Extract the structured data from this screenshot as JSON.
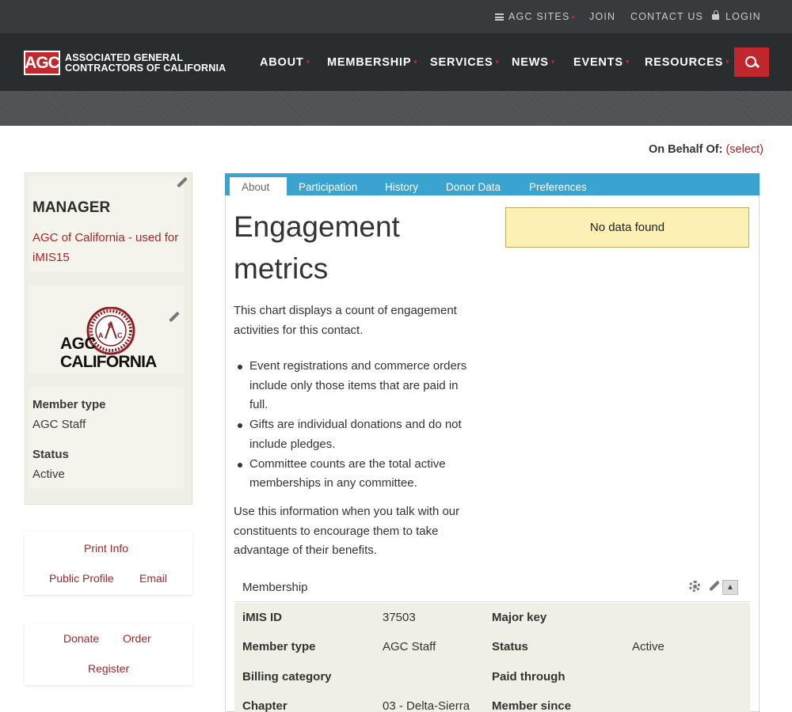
{
  "topbar": {
    "agc_sites": "AGC SITES",
    "join": "JOIN",
    "contact_us": "CONTACT US",
    "login": "LOGIN"
  },
  "brand": {
    "logo_mark": "AGC",
    "line1": "ASSOCIATED GENERAL",
    "line2": "CONTRACTORS OF CALIFORNIA",
    "accent_color": "#c0282d"
  },
  "nav": {
    "items": [
      "ABOUT",
      "MEMBERSHIP",
      "SERVICES",
      "NEWS",
      "EVENTS",
      "RESOURCES"
    ]
  },
  "behalf": {
    "label": "On Behalf Of:",
    "link": "(select)"
  },
  "sidebar": {
    "role": "MANAGER",
    "org_link": "AGC of California - used for iMIS15",
    "logo_line1": "AGC",
    "logo_line2": "CALIFORNIA",
    "member_type_label": "Member type",
    "member_type_value": "AGC Staff",
    "status_label": "Status",
    "status_value": "Active",
    "links1": {
      "print_info": "Print Info",
      "public_profile": "Public Profile",
      "email": "Email"
    },
    "links2": {
      "donate": "Donate",
      "order": "Order",
      "register": "Register"
    }
  },
  "tabs": [
    "About",
    "Participation",
    "History",
    "Donor Data",
    "Preferences"
  ],
  "engagement": {
    "title": "Engagement metrics",
    "intro": "This chart displays a count of engagement activities for this contact.",
    "bullets": [
      "Event registrations and commerce orders include only those items that are paid in full.",
      "Gifts are individual donations and do not include pledges.",
      "Committee counts are the total active memberships in any committee."
    ],
    "outro": "Use this information when you talk with our constituents to encourage them to take advantage of their benefits.",
    "no_data": "No data found"
  },
  "membership": {
    "title": "Membership",
    "collapse_glyph": "▲",
    "rows": [
      {
        "k1": "iMIS ID",
        "v1": "37503",
        "k2": "Major key",
        "v2": ""
      },
      {
        "k1": "Member type",
        "v1": "AGC Staff",
        "k2": "Status",
        "v2": "Active"
      },
      {
        "k1": "Billing category",
        "v1": "",
        "k2": "Paid through",
        "v2": ""
      },
      {
        "k1": "Chapter",
        "v1": "03 - Delta-Sierra",
        "k2": "Member since",
        "v2": ""
      }
    ]
  }
}
